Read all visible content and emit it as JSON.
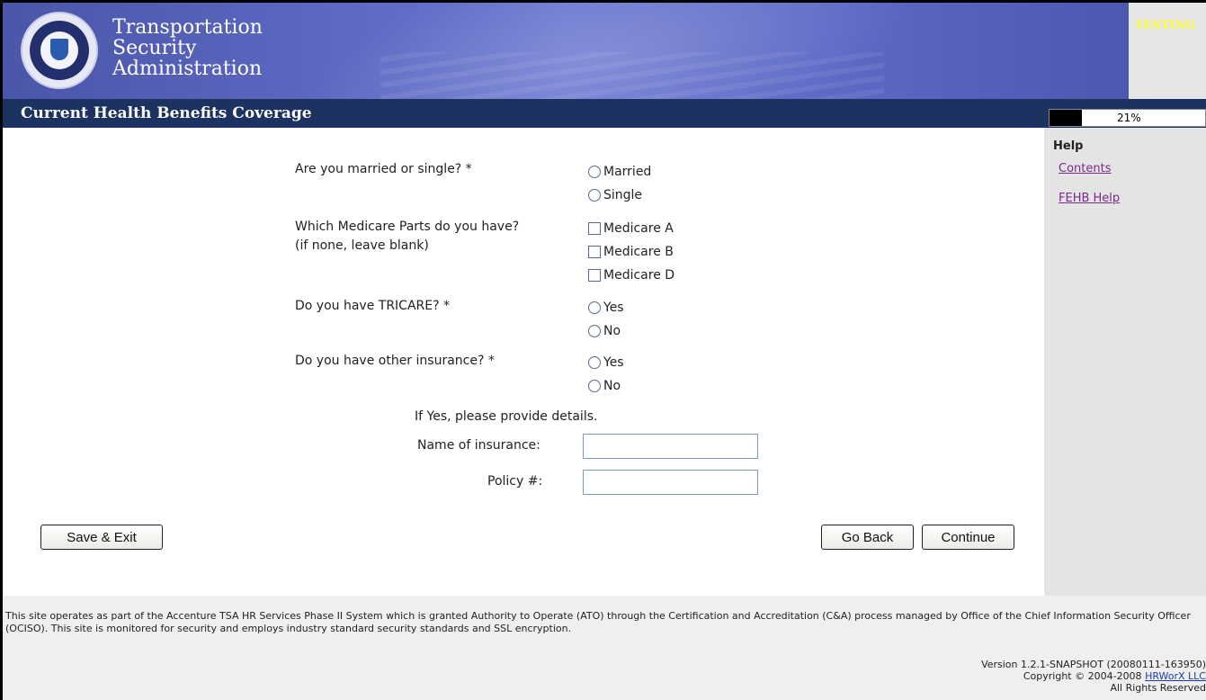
{
  "header": {
    "agency_lines": [
      "Transportation",
      "Security",
      "Administration"
    ],
    "env_badge": "TESTING"
  },
  "titlebar": {
    "title": "Current Health Benefits Coverage",
    "progress_text": "21%",
    "progress_value": 0.21
  },
  "sidebar": {
    "heading": "Help",
    "links": [
      "Contents",
      "FEHB Help"
    ]
  },
  "form": {
    "marital": {
      "question": "Are you married or single? *",
      "options": [
        "Married",
        "Single"
      ]
    },
    "medicare": {
      "question_line1": "Which Medicare Parts do you have?",
      "question_line2": "(if none, leave blank)",
      "options": [
        "Medicare A",
        "Medicare B",
        "Medicare D"
      ]
    },
    "tricare": {
      "question": "Do you have TRICARE? *",
      "options": [
        "Yes",
        "No"
      ]
    },
    "other_insurance": {
      "question": "Do you have other insurance? *",
      "options": [
        "Yes",
        "No"
      ]
    },
    "details_prompt": "If Yes, please provide details.",
    "insurance_name_label": "Name of insurance:",
    "insurance_name_value": "",
    "policy_label": "Policy #:",
    "policy_value": ""
  },
  "buttons": {
    "save_exit": "Save & Exit",
    "go_back": "Go Back",
    "continue": "Continue"
  },
  "footer": {
    "notice": "This site operates as part of the Accenture TSA HR Services Phase II System which is granted Authority to Operate (ATO) through the Certification and Accreditation (C&A) process managed by Office of the Chief Information Security Officer (OCISO). This site is monitored for security and employs industry standard security standards and SSL encryption.",
    "version": "Version 1.2.1-SNAPSHOT (20080111-163950)",
    "copyright_prefix": "Copyright © 2004-2008 ",
    "copyright_link": "HRWorX LLC",
    "rights": "All Rights Reserved"
  },
  "colors": {
    "banner_blue": "#5a66be",
    "titlebar_navy": "#1c3260",
    "testing_yellow": "#ffff33",
    "help_link_purple": "#7a2a8a"
  }
}
